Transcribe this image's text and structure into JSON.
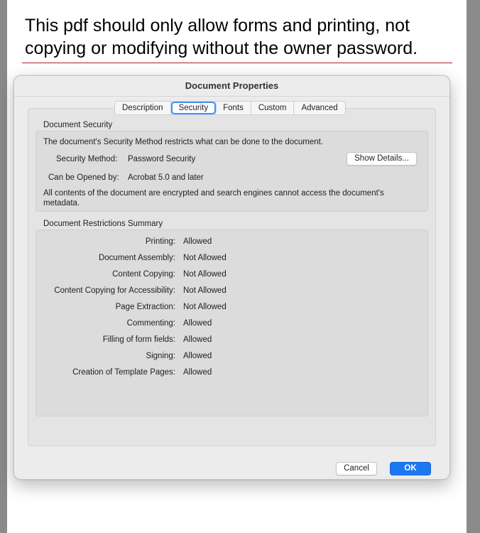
{
  "heading": "This pdf should only allow forms and printing, not copying or modifying without the owner password.",
  "dialog": {
    "title": "Document Properties",
    "tabs": [
      "Description",
      "Security",
      "Fonts",
      "Custom",
      "Advanced"
    ],
    "active_tab": "Security",
    "document_security": {
      "section_label": "Document Security",
      "intro": "The document's Security Method restricts what can be done to the document.",
      "security_method_label": "Security Method:",
      "security_method_value": "Password Security",
      "show_details_label": "Show Details...",
      "opened_by_label": "Can be Opened by:",
      "opened_by_value": "Acrobat 5.0 and later",
      "encryption_note_line1": "All contents of the document are encrypted and search engines cannot access the document's",
      "encryption_note_line2": "metadata."
    },
    "restrictions": {
      "section_label": "Document Restrictions Summary",
      "rows": [
        {
          "label": "Printing:",
          "value": "Allowed"
        },
        {
          "label": "Document Assembly:",
          "value": "Not Allowed"
        },
        {
          "label": "Content Copying:",
          "value": "Not Allowed"
        },
        {
          "label": "Content Copying for Accessibility:",
          "value": "Not Allowed"
        },
        {
          "label": "Page Extraction:",
          "value": "Not Allowed"
        },
        {
          "label": "Commenting:",
          "value": "Allowed"
        },
        {
          "label": "Filling of form fields:",
          "value": "Allowed"
        },
        {
          "label": "Signing:",
          "value": "Allowed"
        },
        {
          "label": "Creation of Template Pages:",
          "value": "Allowed"
        }
      ]
    },
    "buttons": {
      "cancel": "Cancel",
      "ok": "OK"
    }
  },
  "colors": {
    "accent": "#1b78f2",
    "rule": "#b0202a"
  }
}
